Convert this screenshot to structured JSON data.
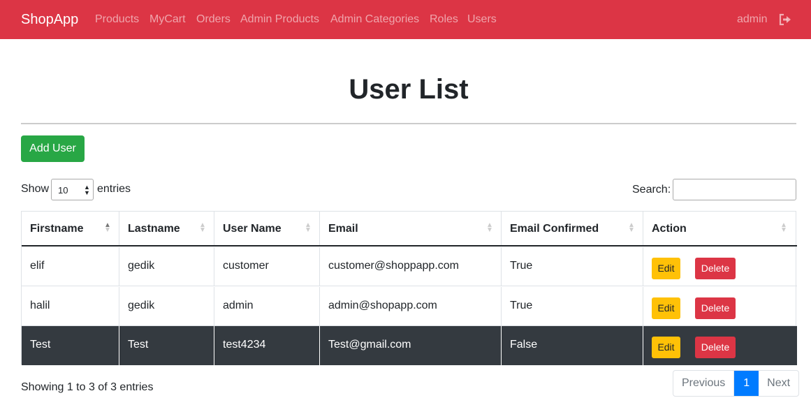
{
  "navbar": {
    "brand": "ShopApp",
    "links": [
      "Products",
      "MyCart",
      "Orders",
      "Admin Products",
      "Admin Categories",
      "Roles",
      "Users"
    ],
    "user": "admin",
    "logout_icon": "sign-out-icon",
    "color": "#dc3545"
  },
  "page": {
    "title": "User List",
    "add_button": "Add User"
  },
  "table_controls": {
    "show_label": "Show",
    "page_length": "10",
    "entries_label": "entries",
    "search_label": "Search:",
    "search_value": ""
  },
  "table": {
    "columns": [
      "Firstname",
      "Lastname",
      "User Name",
      "Email",
      "Email Confirmed",
      "Action"
    ],
    "sorted_column": "Firstname",
    "sort_direction": "ascending",
    "rows": [
      {
        "firstname": "elif",
        "lastname": "gedik",
        "username": "customer",
        "email": "customer@shoppapp.com",
        "confirmed": "True",
        "edit": "Edit",
        "delete": "Delete"
      },
      {
        "firstname": "halil",
        "lastname": "gedik",
        "username": "admin",
        "email": "admin@shopapp.com",
        "confirmed": "True",
        "edit": "Edit",
        "delete": "Delete"
      },
      {
        "firstname": "Test",
        "lastname": "Test",
        "username": "test4234",
        "email": "Test@gmail.com",
        "confirmed": "False",
        "edit": "Edit",
        "delete": "Delete"
      }
    ]
  },
  "footer": {
    "info": "Showing 1 to 3 of 3 entries",
    "previous": "Previous",
    "current_page": "1",
    "next": "Next"
  }
}
